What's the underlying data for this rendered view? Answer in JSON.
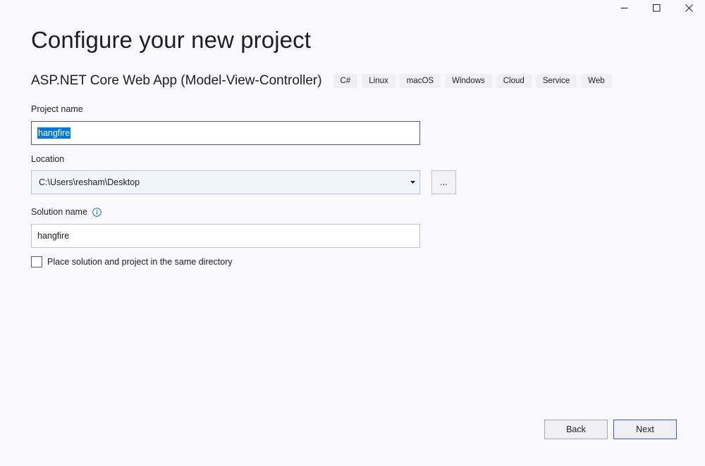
{
  "window": {
    "controls": {
      "minimize": "minimize-icon",
      "maximize": "maximize-icon",
      "close": "close-icon"
    }
  },
  "page": {
    "title": "Configure your new project"
  },
  "template": {
    "name": "ASP.NET Core Web App (Model-View-Controller)",
    "tags": [
      "C#",
      "Linux",
      "macOS",
      "Windows",
      "Cloud",
      "Service",
      "Web"
    ]
  },
  "form": {
    "project_name": {
      "label": "Project name",
      "value": "hangfire"
    },
    "location": {
      "label": "Location",
      "value": "C:\\Users\\resham\\Desktop",
      "browse_label": "..."
    },
    "solution_name": {
      "label": "Solution name",
      "value": "hangfire",
      "info_icon": "info-icon"
    },
    "same_directory": {
      "label": "Place solution and project in the same directory",
      "checked": false
    }
  },
  "footer": {
    "back_label": "Back",
    "next_label": "Next"
  },
  "colors": {
    "background": "#f9f9fc",
    "selection": "#0078d7",
    "primary_border": "#3b5fc0",
    "info_icon": "#1a73c4"
  }
}
